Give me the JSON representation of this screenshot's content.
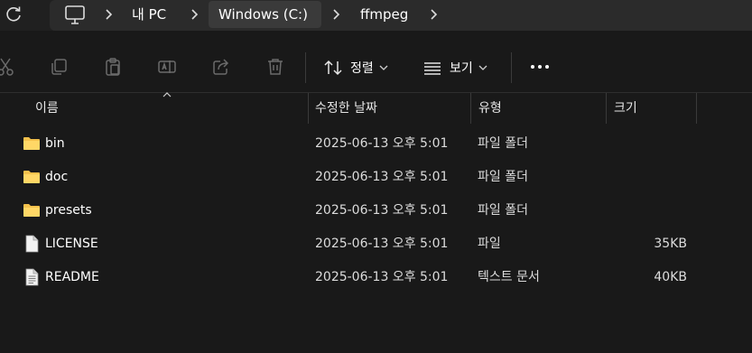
{
  "breadcrumbs": [
    "내 PC",
    "Windows (C:)",
    "ffmpeg"
  ],
  "toolbar": {
    "sort_label": "정렬",
    "view_label": "보기"
  },
  "columns": {
    "name": "이름",
    "date": "수정한 날짜",
    "type": "유형",
    "size": "크기"
  },
  "files": [
    {
      "name": "bin",
      "date": "2025-06-13 오후 5:01",
      "type": "파일 폴더",
      "size": "",
      "icon": "folder-icon"
    },
    {
      "name": "doc",
      "date": "2025-06-13 오후 5:01",
      "type": "파일 폴더",
      "size": "",
      "icon": "folder-icon"
    },
    {
      "name": "presets",
      "date": "2025-06-13 오후 5:01",
      "type": "파일 폴더",
      "size": "",
      "icon": "folder-icon"
    },
    {
      "name": "LICENSE",
      "date": "2025-06-13 오후 5:01",
      "type": "파일",
      "size": "35KB",
      "icon": "file-icon"
    },
    {
      "name": "README",
      "date": "2025-06-13 오후 5:01",
      "type": "텍스트 문서",
      "size": "40KB",
      "icon": "text-file-icon"
    }
  ],
  "colors": {
    "background": "#191919",
    "address_bar": "#202020",
    "breadcrumb_bg": "#2b2b2b",
    "folder": "#f4c14c"
  }
}
